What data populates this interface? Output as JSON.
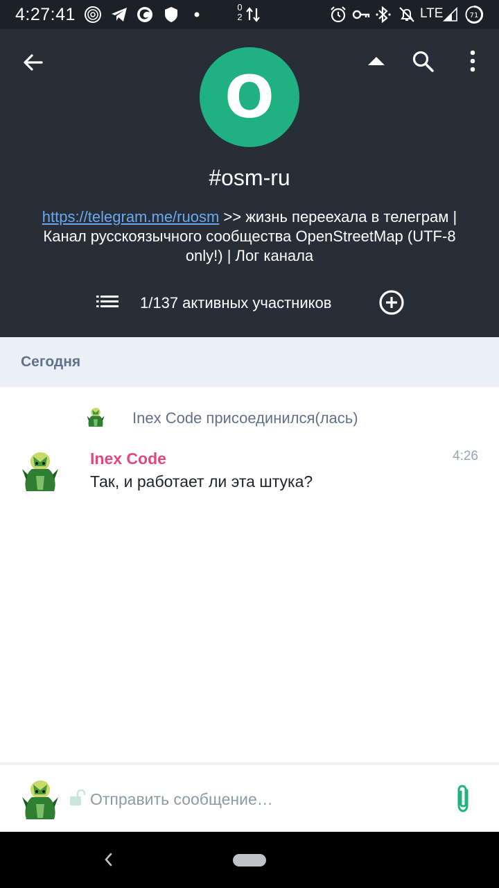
{
  "status_bar": {
    "time": "4:27:41",
    "network_type": "LTE",
    "net_top": "0",
    "net_bottom": "2",
    "battery_level": "71",
    "icons": [
      "vpn-circle-icon",
      "telegram-icon",
      "firefox-icon",
      "shield-icon",
      "dot-icon",
      "data-arrows-icon",
      "alarm-icon",
      "key-icon",
      "bluetooth-icon",
      "mute-icon",
      "signal-icon",
      "battery-icon"
    ]
  },
  "header": {
    "avatar_letter": "O",
    "room_name": "#osm-ru",
    "topic_link": "https://telegram.me/ruosm",
    "topic_rest": " >> жизнь переехала в телеграм | Канал русскоязычного сообщества OpenStreetMap (UTF-8 only!) | Лог канала",
    "members_text": "1/137 активных участников",
    "colors": {
      "background": "#272e37",
      "avatar": "#1fb181",
      "link": "#6aa9ee"
    }
  },
  "timeline": {
    "date_separator": "Сегодня",
    "membership_event": "Inex Code присоединился(лась)",
    "messages": [
      {
        "sender": "Inex Code",
        "time": "4:26",
        "body": "Так, и работает ли эта штука?"
      }
    ],
    "colors": {
      "sender": "#e0497c"
    }
  },
  "composer": {
    "placeholder": "Отправить сообщение…",
    "value": ""
  }
}
